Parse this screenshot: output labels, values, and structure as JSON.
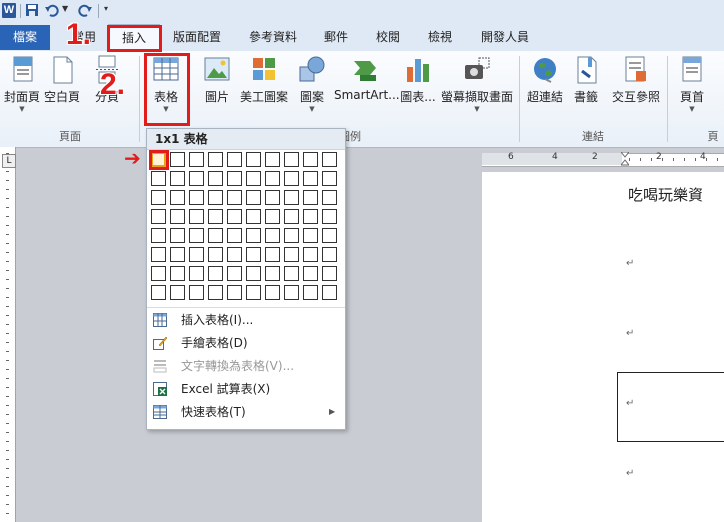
{
  "qat": {
    "app_logo": "W",
    "icons": [
      "save-icon",
      "undo-icon",
      "redo-icon",
      "customize-icon"
    ]
  },
  "tabs": {
    "file": "檔案",
    "home": "常用",
    "insert": "插入",
    "layout": "版面配置",
    "references": "參考資料",
    "mailings": "郵件",
    "review": "校閱",
    "view": "檢視",
    "developer": "開發人員"
  },
  "ribbon": {
    "cover_page": "封面頁",
    "blank_page": "空白頁",
    "page_break": "分頁",
    "table": "表格",
    "picture": "圖片",
    "clipart": "美工圖案",
    "shapes": "圖案",
    "smartart": "SmartArt...",
    "chart": "圖表...",
    "screenshot": "螢幕擷取畫面",
    "hyperlink": "超連結",
    "bookmark": "書籤",
    "cross_ref": "交互參照",
    "header": "頁首",
    "groups": {
      "pages": "頁面",
      "illustrations": "圖例",
      "links": "連結",
      "header_partial": "頁"
    }
  },
  "table_menu": {
    "title": "1x1 表格",
    "rows": 8,
    "cols": 10,
    "selected": [
      1,
      1
    ],
    "items": {
      "insert_table": "插入表格(I)...",
      "draw_table": "手繪表格(D)",
      "text_to_table": "文字轉換為表格(V)...",
      "excel": "Excel 試算表(X)",
      "quick_tables": "快速表格(T)"
    }
  },
  "ruler": {
    "tab_selector": "L",
    "numbers": [
      "6",
      "4",
      "2",
      "2",
      "4"
    ]
  },
  "document": {
    "title": "吃喝玩樂資",
    "paragraph_mark": "↵"
  },
  "annotations": {
    "step1": "1.",
    "step2": "2.",
    "arrow": "➔"
  },
  "colors": {
    "annotation_red": "#e21b1b",
    "file_tab_blue": "#2a64b6",
    "selected_cell": "#e8a317"
  }
}
